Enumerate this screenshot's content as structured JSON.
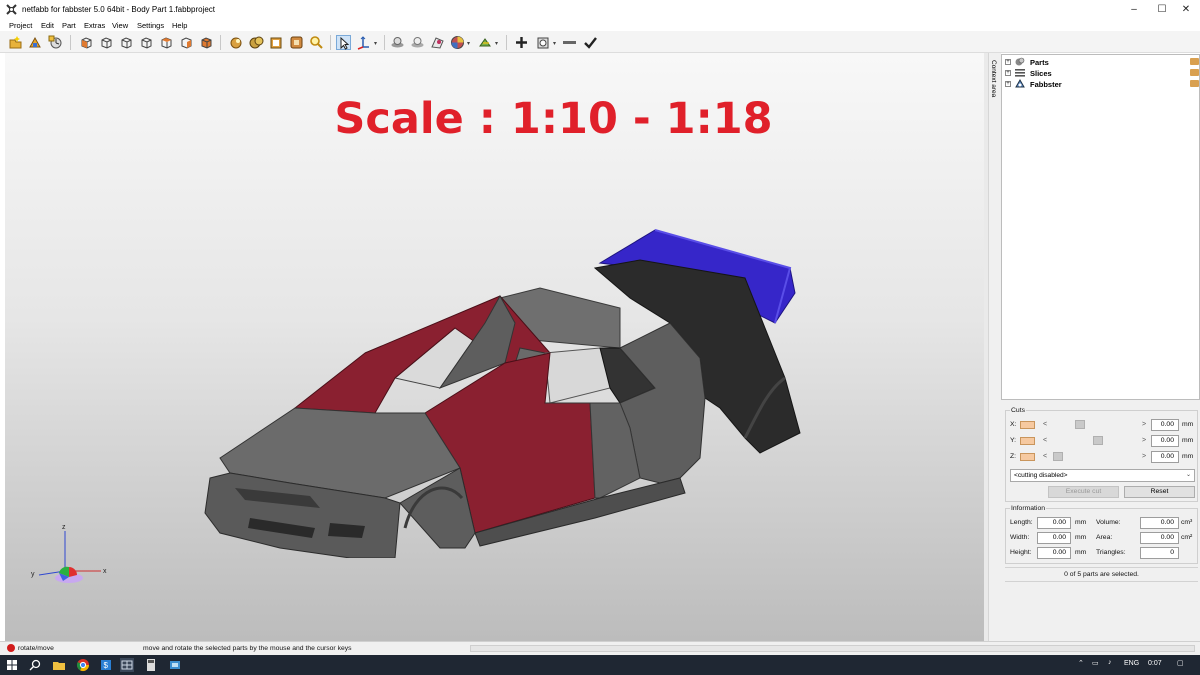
{
  "window": {
    "title": "netfabb for fabbster 5.0 64bit - Body Part 1.fabbproject",
    "minimize": "–",
    "maximize": "☐",
    "close": "✕"
  },
  "menu": [
    "Project",
    "Edit",
    "Part",
    "Extras",
    "View",
    "Settings",
    "Help"
  ],
  "viewport": {
    "overlay_title": "Scale : 1:10 - 1:18",
    "axis_labels": {
      "x": "x",
      "y": "y",
      "z": "z"
    }
  },
  "side_tab": {
    "label": "Context area"
  },
  "tree": [
    {
      "label": "Parts"
    },
    {
      "label": "Slices"
    },
    {
      "label": "Fabbster"
    }
  ],
  "cuts": {
    "heading": "Cuts",
    "rows": [
      {
        "axis": "X:",
        "value": "0.00",
        "unit": "mm",
        "position": 0.3
      },
      {
        "axis": "Y:",
        "value": "0.00",
        "unit": "mm",
        "position": 0.52
      },
      {
        "axis": "Z:",
        "value": "0.00",
        "unit": "mm",
        "position": 0.04
      }
    ],
    "arrow_left": "<",
    "arrow_right": ">",
    "select_value": "<cutting disabled>",
    "execute_label": "Execute cut",
    "reset_label": "Reset"
  },
  "information": {
    "heading": "Information",
    "length_label": "Length:",
    "length_value": "0.00",
    "length_unit": "mm",
    "width_label": "Width:",
    "width_value": "0.00",
    "width_unit": "mm",
    "height_label": "Height:",
    "height_value": "0.00",
    "height_unit": "mm",
    "volume_label": "Volume:",
    "volume_value": "0.00",
    "volume_unit": "cm³",
    "area_label": "Area:",
    "area_value": "0.00",
    "area_unit": "cm²",
    "triangles_label": "Triangles:",
    "triangles_value": "0"
  },
  "selection_status": "0 of 5 parts are selected.",
  "statusbar": {
    "mode": "rotate/move",
    "hint": "move and rotate the selected parts by the mouse and the cursor keys"
  },
  "taskbar": {
    "language": "ENG",
    "time": "0:07"
  },
  "colors": {
    "title_red": "#e0202a",
    "car_grey": "#6b6b6b",
    "car_maroon": "#8a2030",
    "car_black": "#2a2a2a",
    "spoiler_blue": "#3a2bd0",
    "taskbar": "#1f2733"
  },
  "icons": [
    "new-project-icon",
    "open-icon",
    "save-icon",
    "view-front-icon",
    "view-back-icon",
    "view-left-icon",
    "view-right-icon",
    "view-top-icon",
    "view-bottom-icon",
    "view-iso-icon",
    "zoom-icon",
    "select-pointer-icon",
    "move-icon",
    "render-icon",
    "repair-icon",
    "color-icon",
    "measure-icon",
    "add-part-icon",
    "cut-icon",
    "remove-icon",
    "apply-check-icon"
  ]
}
